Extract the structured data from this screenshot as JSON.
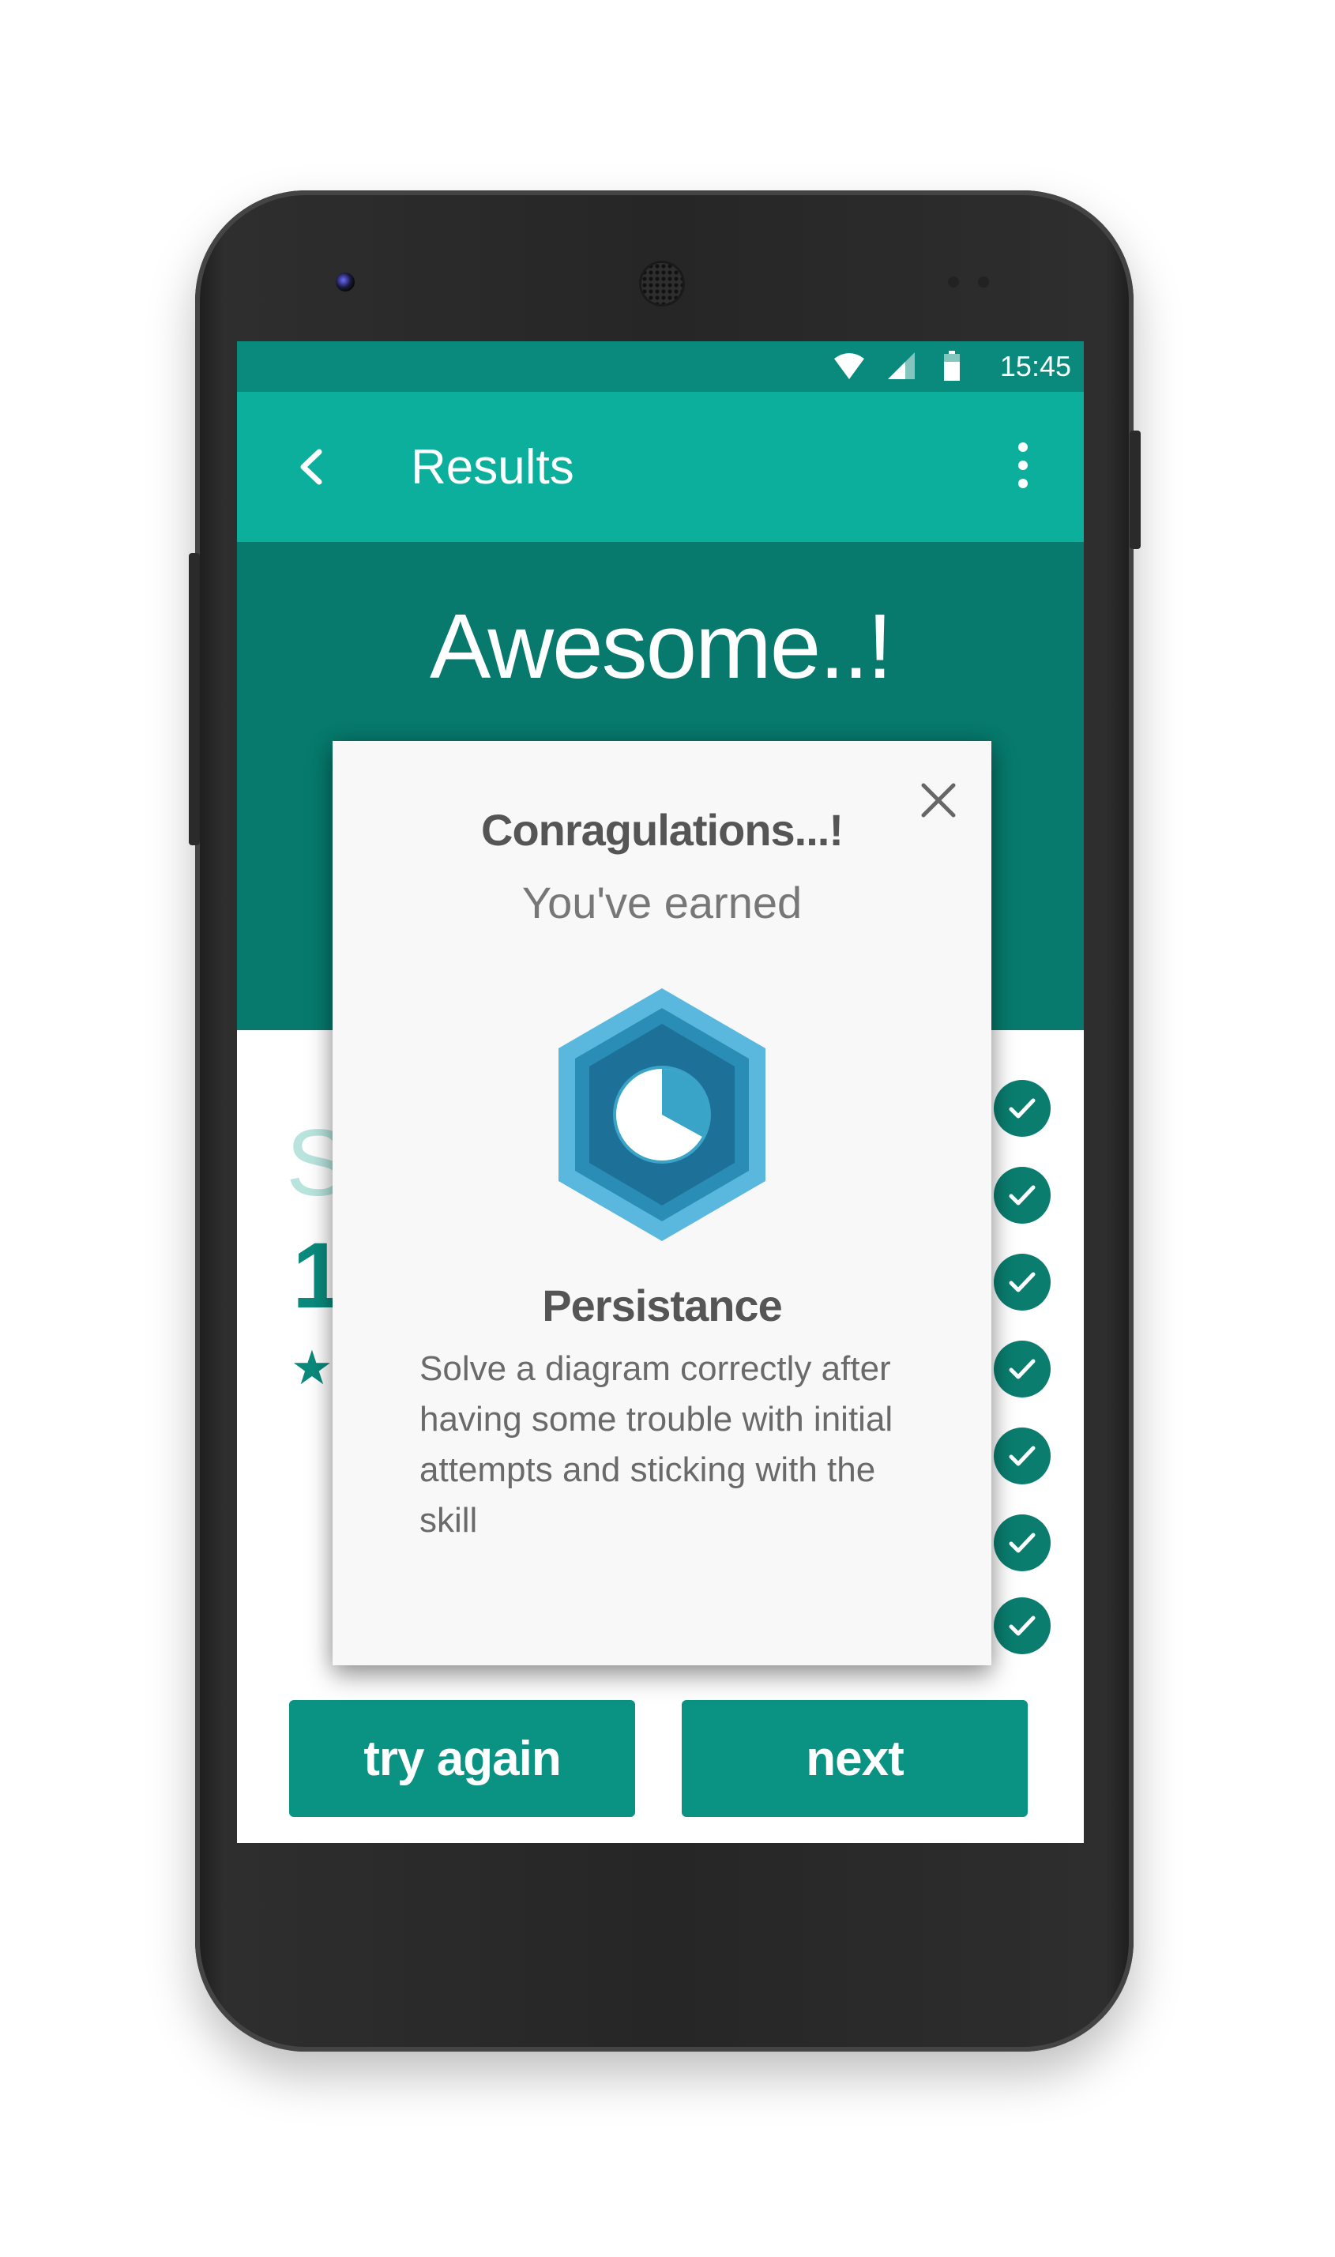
{
  "status_bar": {
    "time": "15:45"
  },
  "app_bar": {
    "title": "Results"
  },
  "hero": {
    "title": "Awesome..!"
  },
  "background_content": {
    "partial_letter": "S",
    "partial_number": "1",
    "star_glyph": "★",
    "check_count": 7
  },
  "dialog": {
    "title": "Conragulations...!",
    "subtitle": "You've  earned",
    "badge_name": "Persistance",
    "badge_description": "Solve a diagram correctly after having some trouble with initial attempts and sticking with the skill"
  },
  "buttons": {
    "try_again": "try again",
    "next": "next"
  },
  "colors": {
    "status_bar": "#098a7c",
    "app_bar": "#0cae9c",
    "hero": "#077a6d",
    "button": "#0a9282",
    "check": "#0a7d6f",
    "badge_outer": "#5ab8de",
    "badge_inner": "#2a8db5"
  },
  "icons": {
    "back": "chevron-left-icon",
    "menu": "more-vertical-icon",
    "close": "close-icon",
    "wifi": "wifi-icon",
    "signal": "signal-icon",
    "battery": "battery-icon",
    "check": "check-icon",
    "badge": "hexagon-pie-badge-icon"
  }
}
